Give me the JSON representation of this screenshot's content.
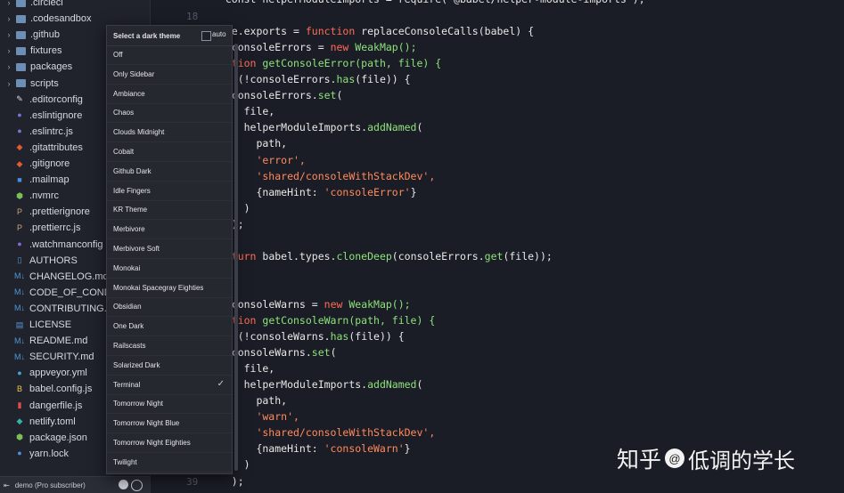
{
  "sidebar": {
    "items": [
      {
        "label": ".circleci",
        "kind": "folder"
      },
      {
        "label": ".codesandbox",
        "kind": "folder"
      },
      {
        "label": ".github",
        "kind": "folder"
      },
      {
        "label": "fixtures",
        "kind": "folder"
      },
      {
        "label": "packages",
        "kind": "folder"
      },
      {
        "label": "scripts",
        "kind": "folder"
      },
      {
        "label": ".editorconfig",
        "kind": "file",
        "icon": "editorconfig-icon",
        "color": "#d7dae0",
        "glyph": "✎"
      },
      {
        "label": ".eslintignore",
        "kind": "file",
        "icon": "eslint-icon",
        "color": "#6c7bd1",
        "glyph": "●"
      },
      {
        "label": ".eslintrc.js",
        "kind": "file",
        "icon": "eslint-icon",
        "color": "#6c7bd1",
        "glyph": "●"
      },
      {
        "label": ".gitattributes",
        "kind": "file",
        "icon": "git-icon",
        "color": "#e45a34",
        "glyph": "◆"
      },
      {
        "label": ".gitignore",
        "kind": "file",
        "icon": "git-icon",
        "color": "#e45a34",
        "glyph": "◆"
      },
      {
        "label": ".mailmap",
        "kind": "file",
        "icon": "mail-icon",
        "color": "#4a8ee0",
        "glyph": "■"
      },
      {
        "label": ".nvmrc",
        "kind": "file",
        "icon": "node-icon",
        "color": "#7cbf55",
        "glyph": "⬢"
      },
      {
        "label": ".prettierignore",
        "kind": "file",
        "icon": "prettier-icon",
        "color": "#c8a678",
        "glyph": "P"
      },
      {
        "label": ".prettierrc.js",
        "kind": "file",
        "icon": "prettier-icon",
        "color": "#c8a678",
        "glyph": "P"
      },
      {
        "label": ".watchmanconfig",
        "kind": "file",
        "icon": "watchman-icon",
        "color": "#7f6cd6",
        "glyph": "●"
      },
      {
        "label": "AUTHORS",
        "kind": "file",
        "icon": "document-icon",
        "color": "#5c9ad6",
        "glyph": "▯"
      },
      {
        "label": "CHANGELOG.md",
        "kind": "file",
        "icon": "markdown-icon",
        "color": "#4e9ad8",
        "glyph": "M↓"
      },
      {
        "label": "CODE_OF_CONDU",
        "kind": "file",
        "icon": "markdown-icon",
        "color": "#4e9ad8",
        "glyph": "M↓"
      },
      {
        "label": "CONTRIBUTING.m",
        "kind": "file",
        "icon": "markdown-icon",
        "color": "#4e9ad8",
        "glyph": "M↓"
      },
      {
        "label": "LICENSE",
        "kind": "file",
        "icon": "license-icon",
        "color": "#5c9ad6",
        "glyph": "▤"
      },
      {
        "label": "README.md",
        "kind": "file",
        "icon": "markdown-icon",
        "color": "#4e9ad8",
        "glyph": "M↓"
      },
      {
        "label": "SECURITY.md",
        "kind": "file",
        "icon": "markdown-icon",
        "color": "#4e9ad8",
        "glyph": "M↓"
      },
      {
        "label": "appveyor.yml",
        "kind": "file",
        "icon": "appveyor-icon",
        "color": "#4aa3d8",
        "glyph": "●"
      },
      {
        "label": "babel.config.js",
        "kind": "file",
        "icon": "babel-icon",
        "color": "#f1c84b",
        "glyph": "B"
      },
      {
        "label": "dangerfile.js",
        "kind": "file",
        "icon": "danger-icon",
        "color": "#e04c4c",
        "glyph": "▮"
      },
      {
        "label": "netlify.toml",
        "kind": "file",
        "icon": "netlify-icon",
        "color": "#36b3a8",
        "glyph": "◆"
      },
      {
        "label": "package.json",
        "kind": "file",
        "icon": "npm-icon",
        "color": "#7cbf55",
        "glyph": "⬢"
      },
      {
        "label": "yarn.lock",
        "kind": "file",
        "icon": "yarn-icon",
        "color": "#4d8fd8",
        "glyph": "●"
      }
    ],
    "status_text": "demo (Pro subscriber)"
  },
  "editor": {
    "line_numbers": [
      "18",
      "39"
    ],
    "lines": [
      [
        {
          "t": "  const helperModuleImports = require('@babel/helper-module-imports');",
          "c": "plain"
        }
      ],
      [
        {
          "t": "",
          "c": "plain"
        }
      ],
      [
        {
          "t": "dule.exports = ",
          "c": "plain"
        },
        {
          "t": "function",
          "c": "kw"
        },
        {
          "t": " replaceConsoleCalls(babel) {",
          "c": "plain"
        }
      ],
      [
        {
          "t": "st",
          "c": "kw"
        },
        {
          "t": " consoleErrors = ",
          "c": "plain"
        },
        {
          "t": "new",
          "c": "kw"
        },
        {
          "t": " WeakMap();",
          "c": "fn"
        }
      ],
      [
        {
          "t": "unction",
          "c": "kw"
        },
        {
          "t": " getConsoleError(path, file) {",
          "c": "fn"
        }
      ],
      [
        {
          "t": " if",
          "c": "kw"
        },
        {
          "t": " (!consoleErrors.",
          "c": "plain"
        },
        {
          "t": "has",
          "c": "fn"
        },
        {
          "t": "(file)) {",
          "c": "plain"
        }
      ],
      [
        {
          "t": "   consoleErrors.",
          "c": "plain"
        },
        {
          "t": "set",
          "c": "fn"
        },
        {
          "t": "(",
          "c": "plain"
        }
      ],
      [
        {
          "t": "     file,",
          "c": "plain"
        }
      ],
      [
        {
          "t": "     helperModuleImports.",
          "c": "plain"
        },
        {
          "t": "addNamed",
          "c": "fn"
        },
        {
          "t": "(",
          "c": "plain"
        }
      ],
      [
        {
          "t": "       path,",
          "c": "plain"
        }
      ],
      [
        {
          "t": "       'error',",
          "c": "str"
        }
      ],
      [
        {
          "t": "       'shared/consoleWithStackDev',",
          "c": "str"
        }
      ],
      [
        {
          "t": "       {nameHint: ",
          "c": "plain"
        },
        {
          "t": "'consoleError'",
          "c": "str"
        },
        {
          "t": "}",
          "c": "plain"
        }
      ],
      [
        {
          "t": "     )",
          "c": "plain"
        }
      ],
      [
        {
          "t": "   );",
          "c": "plain"
        }
      ],
      [
        {
          "t": " }",
          "c": "plain"
        }
      ],
      [
        {
          "t": " return",
          "c": "kw"
        },
        {
          "t": " babel.types.",
          "c": "plain"
        },
        {
          "t": "cloneDeep",
          "c": "fn"
        },
        {
          "t": "(consoleErrors.",
          "c": "plain"
        },
        {
          "t": "get",
          "c": "fn"
        },
        {
          "t": "(file));",
          "c": "plain"
        }
      ],
      [
        {
          "t": "",
          "c": "plain"
        }
      ],
      [
        {
          "t": "",
          "c": "plain"
        }
      ],
      [
        {
          "t": "st",
          "c": "kw"
        },
        {
          "t": " consoleWarns = ",
          "c": "plain"
        },
        {
          "t": "new",
          "c": "kw"
        },
        {
          "t": " WeakMap();",
          "c": "fn"
        }
      ],
      [
        {
          "t": "unction",
          "c": "kw"
        },
        {
          "t": " getConsoleWarn(path, file) {",
          "c": "fn"
        }
      ],
      [
        {
          "t": " if",
          "c": "kw"
        },
        {
          "t": " (!consoleWarns.",
          "c": "plain"
        },
        {
          "t": "has",
          "c": "fn"
        },
        {
          "t": "(file)) {",
          "c": "plain"
        }
      ],
      [
        {
          "t": "   consoleWarns.",
          "c": "plain"
        },
        {
          "t": "set",
          "c": "fn"
        },
        {
          "t": "(",
          "c": "plain"
        }
      ],
      [
        {
          "t": "     file,",
          "c": "plain"
        }
      ],
      [
        {
          "t": "     helperModuleImports.",
          "c": "plain"
        },
        {
          "t": "addNamed",
          "c": "fn"
        },
        {
          "t": "(",
          "c": "plain"
        }
      ],
      [
        {
          "t": "       path,",
          "c": "plain"
        }
      ],
      [
        {
          "t": "       'warn',",
          "c": "str"
        }
      ],
      [
        {
          "t": "       'shared/consoleWithStackDev',",
          "c": "str"
        }
      ],
      [
        {
          "t": "       {nameHint: ",
          "c": "plain"
        },
        {
          "t": "'consoleWarn'",
          "c": "str"
        },
        {
          "t": "}",
          "c": "plain"
        }
      ],
      [
        {
          "t": "     )",
          "c": "plain"
        }
      ],
      [
        {
          "t": "   );",
          "c": "plain"
        }
      ]
    ]
  },
  "theme_menu": {
    "title": "Select a dark theme",
    "auto_label": "auto",
    "selected": "Terminal",
    "items": [
      "Off",
      "Only Sidebar",
      "Ambiance",
      "Chaos",
      "Clouds Midnight",
      "Cobalt",
      "Github Dark",
      "Idle Fingers",
      "KR Theme",
      "Merbivore",
      "Merbivore Soft",
      "Monokai",
      "Monokai Spacegray Eighties",
      "Obsidian",
      "One Dark",
      "Railscasts",
      "Solarized Dark",
      "Terminal",
      "Tomorrow Night",
      "Tomorrow Night Blue",
      "Tomorrow Night Eighties",
      "Twilight"
    ]
  },
  "watermark": {
    "prefix": "知乎",
    "at": "@",
    "name": "低调的学长"
  }
}
